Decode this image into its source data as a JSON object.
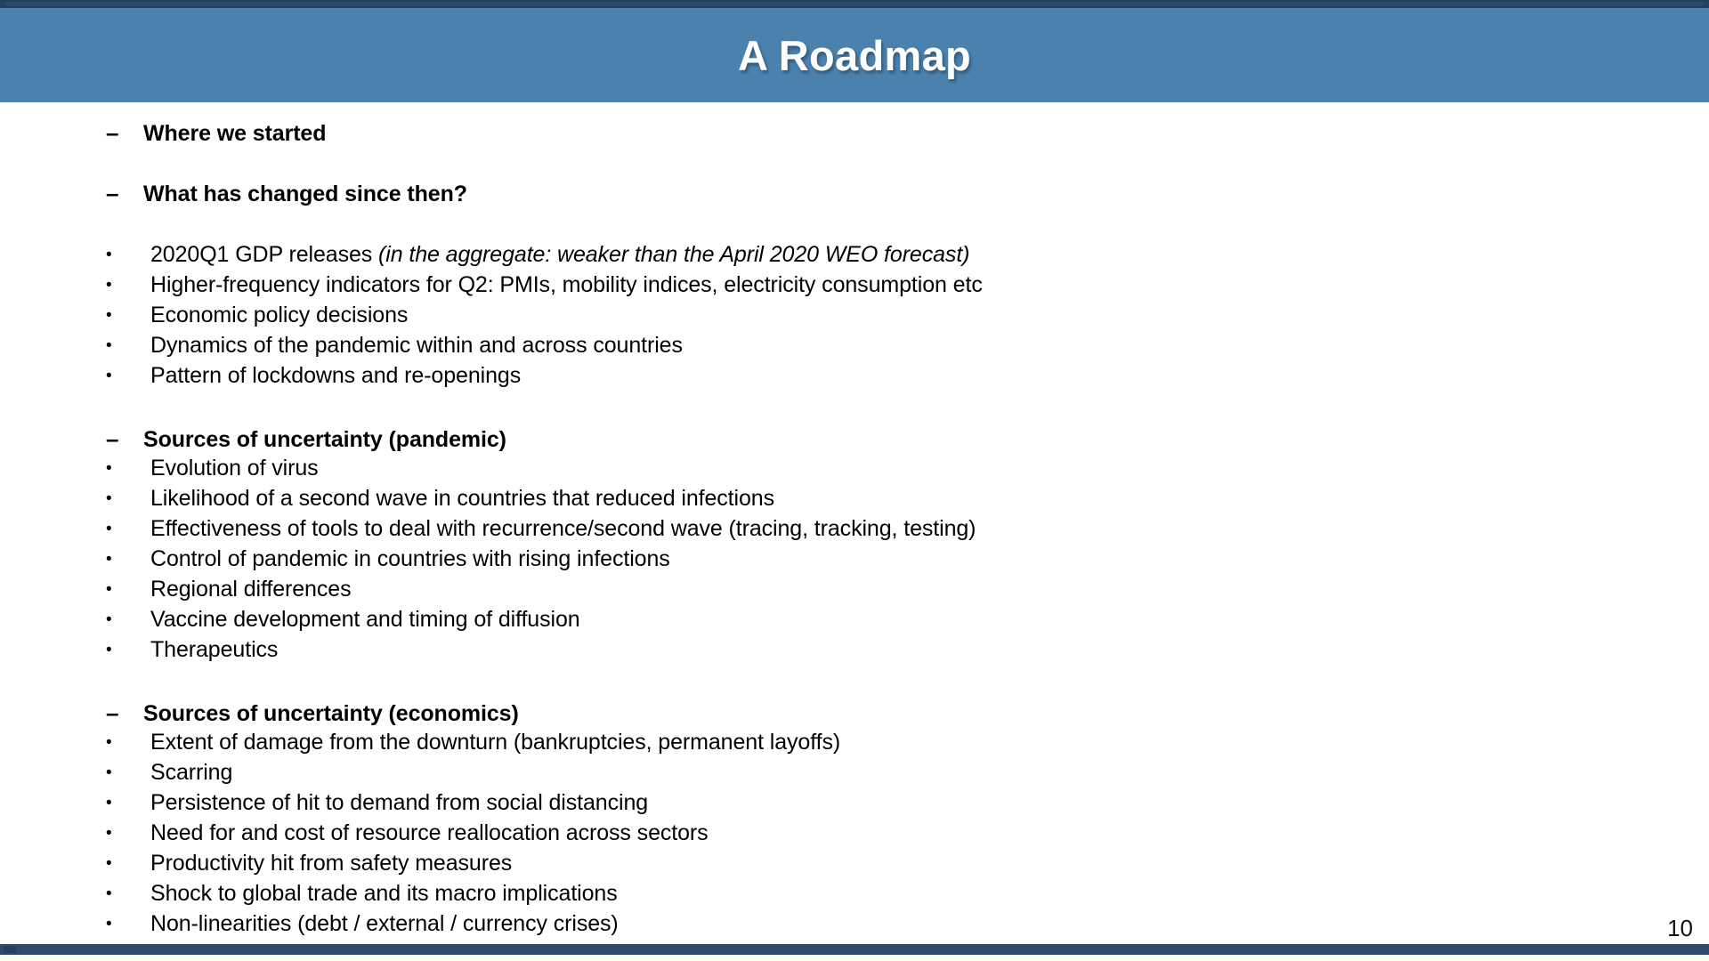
{
  "slide": {
    "title": "A Roadmap",
    "page_number": "10",
    "colors": {
      "title_band": "#4A81AD",
      "rule_dark": "#22405F",
      "rule_mid": "#2C4A6B",
      "background": "#FFFFFF",
      "text": "#000000",
      "title_text": "#FFFFFF"
    },
    "markers": {
      "dash": "–",
      "bullet": "•"
    }
  },
  "content": {
    "headings": {
      "where_we_started": "Where we started",
      "what_has_changed": "What has changed since then?",
      "sources_pandemic": "Sources of uncertainty (pandemic)",
      "sources_economics": "Sources of uncertainty (economics)"
    },
    "changed_bullets": [
      {
        "lead": "2020Q1 GDP releases ",
        "italic": "(in the aggregate: weaker than the April 2020 WEO forecast)"
      },
      {
        "lead": "Higher-frequency indicators for Q2: PMIs, mobility indices, electricity consumption etc",
        "italic": ""
      },
      {
        "lead": "Economic policy decisions",
        "italic": ""
      },
      {
        "lead": "Dynamics of the pandemic within and across countries",
        "italic": ""
      },
      {
        "lead": "Pattern of lockdowns and re-openings",
        "italic": ""
      }
    ],
    "pandemic_bullets": [
      "Evolution of virus",
      "Likelihood of a second wave in countries that reduced infections",
      "Effectiveness of tools to deal with recurrence/second wave (tracing, tracking, testing)",
      "Control of pandemic in countries with rising infections",
      "Regional differences",
      "Vaccine development and timing of diffusion",
      "Therapeutics"
    ],
    "economics_bullets": [
      "Extent of damage from the downturn (bankruptcies, permanent layoffs)",
      "Scarring",
      "Persistence of hit to demand from social distancing",
      "Need for and cost of resource reallocation across sectors",
      "Productivity hit from safety measures",
      "Shock to global trade and its macro implications",
      "Non-linearities (debt / external / currency crises)"
    ]
  }
}
